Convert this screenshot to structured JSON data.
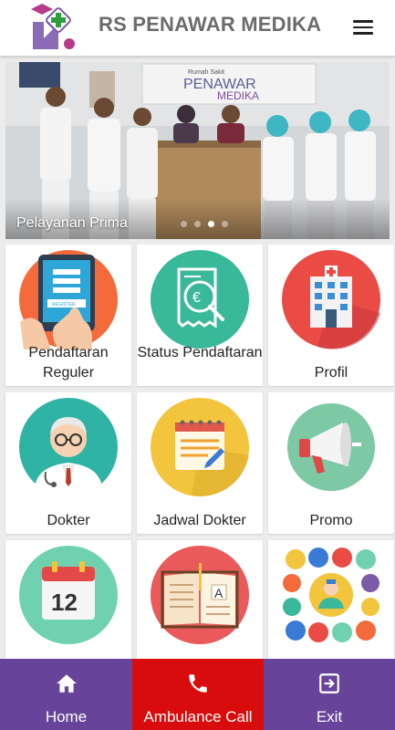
{
  "header": {
    "title": "RS PENAWAR MEDIKA",
    "logo_icon": "hospital-logo-icon",
    "menu_icon": "hamburger-menu-icon"
  },
  "slider": {
    "caption": "Pelayanan Prima",
    "sign_small": "Rumah Sakit",
    "sign_line1": "PENAWAR",
    "sign_line2": "MEDIKA",
    "active_dot": 2,
    "dot_count": 3
  },
  "tiles": [
    {
      "label": "Pendaftaran Reguler",
      "icon": "register-tablet-icon"
    },
    {
      "label": "Status Pendaftaran",
      "icon": "receipt-search-icon"
    },
    {
      "label": "Profil",
      "icon": "hospital-building-icon"
    },
    {
      "label": "Dokter",
      "icon": "doctor-icon"
    },
    {
      "label": "Jadwal Dokter",
      "icon": "schedule-notepad-icon"
    },
    {
      "label": "Promo",
      "icon": "megaphone-icon"
    },
    {
      "label": "",
      "icon": "calendar-icon"
    },
    {
      "label": "",
      "icon": "open-book-icon"
    },
    {
      "label": "",
      "icon": "medical-services-icon"
    }
  ],
  "bottom_nav": [
    {
      "label": "Home",
      "icon": "home-icon",
      "color": "#67449a"
    },
    {
      "label": "Ambulance Call",
      "icon": "phone-icon",
      "color": "#d80c0c"
    },
    {
      "label": "Exit",
      "icon": "exit-icon",
      "color": "#67449a"
    }
  ],
  "colors": {
    "header_title": "#6b6b6b",
    "nav_purple": "#67449a",
    "nav_red": "#d80c0c"
  }
}
